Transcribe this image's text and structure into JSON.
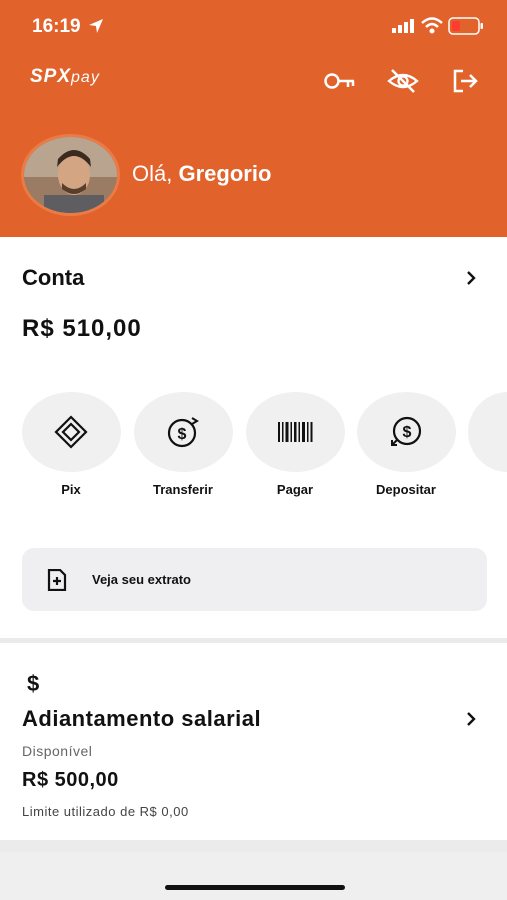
{
  "status_bar": {
    "time": "16:19"
  },
  "brand": {
    "logo_text": "SPX",
    "logo_suffix": "pay",
    "accent_color": "#e2622c"
  },
  "header": {
    "greeting_prefix": "Olá,",
    "user_name": "Gregorio",
    "icons": [
      "key-icon",
      "eye-off-icon",
      "logout-icon"
    ]
  },
  "account": {
    "title": "Conta",
    "balance": "R$ 510,00",
    "actions": [
      {
        "label": "Pix",
        "icon": "pix-icon"
      },
      {
        "label": "Transferir",
        "icon": "transfer-icon"
      },
      {
        "label": "Pagar",
        "icon": "barcode-icon"
      },
      {
        "label": "Depositar",
        "icon": "deposit-icon"
      }
    ],
    "statement_label": "Veja seu extrato"
  },
  "salary_advance": {
    "icon": "dollar-icon",
    "icon_symbol": "$",
    "title": "Adiantamento salarial",
    "available_label": "Disponível",
    "available_value": "R$ 500,00",
    "limit_text": "Limite utilizado de R$ 0,00"
  }
}
